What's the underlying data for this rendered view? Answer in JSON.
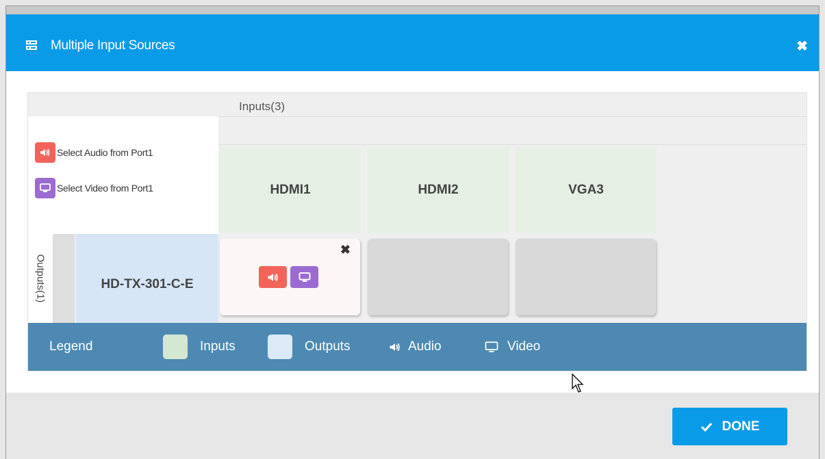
{
  "dialog": {
    "title": "Multiple Input Sources",
    "close_icon": "close-icon",
    "header_icon": "list-icon"
  },
  "matrix": {
    "inputs_label": "Inputs(3)",
    "outputs_label": "Outputs(1)",
    "selection": {
      "audio_text": "Select Audio from Port1",
      "video_text": "Select Video from Port1"
    },
    "inputs": [
      "HDMI1",
      "HDMI2",
      "VGA3"
    ],
    "outputs": [
      "HD-TX-301-C-E"
    ],
    "routes": [
      {
        "input": "HDMI1",
        "audio": true,
        "video": true
      },
      {
        "input": "HDMI2",
        "audio": false,
        "video": false
      },
      {
        "input": "VGA3",
        "audio": false,
        "video": false
      }
    ]
  },
  "legend": {
    "title": "Legend",
    "inputs_label": "Inputs",
    "outputs_label": "Outputs",
    "audio_label": "Audio",
    "video_label": "Video"
  },
  "footer": {
    "done_label": "DONE"
  },
  "colors": {
    "header": "#0a9be8",
    "audio": "#f2645a",
    "video": "#9c6bd2",
    "inputs": "#e5efe4",
    "outputs": "#d6e6f6",
    "legend_bar": "#4d89b2"
  }
}
